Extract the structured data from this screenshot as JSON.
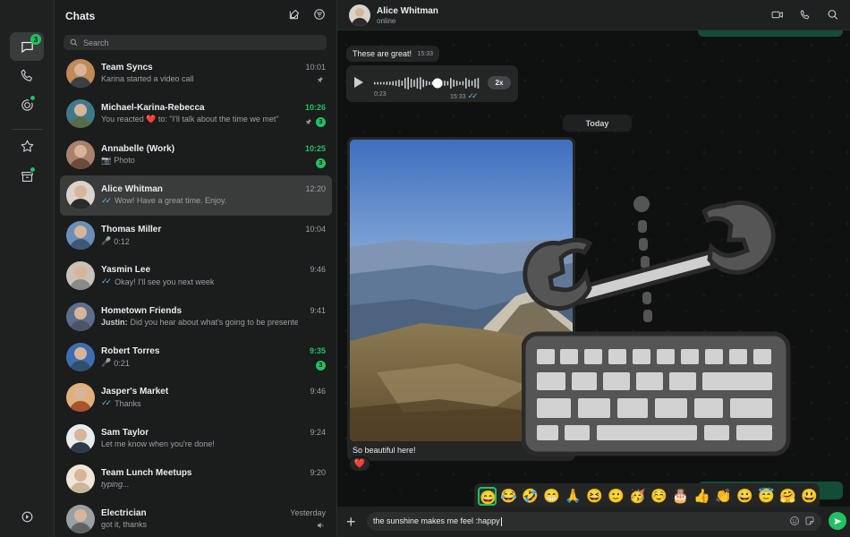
{
  "rail": {
    "chats_badge": "3",
    "icons": [
      "chats-icon",
      "calls-icon",
      "status-icon",
      "starred-icon",
      "archived-icon",
      "settings-icon"
    ]
  },
  "list": {
    "title": "Chats",
    "search_placeholder": "Search",
    "chats": [
      {
        "name": "Team Syncs",
        "time": "10:01",
        "preview": "Karina started a video call",
        "pinned": true,
        "color": "#c28a55"
      },
      {
        "name": "Michael-Karina-Rebecca",
        "time": "10:26",
        "time_green": true,
        "preview": "You reacted ❤️ to: \"I'll talk about the time we met\"",
        "pinned": true,
        "badge": "3",
        "color": "#3f7a8a"
      },
      {
        "name": "Annabelle (Work)",
        "time": "10:25",
        "time_green": true,
        "preview_icon": "📷",
        "preview": "Photo",
        "badge": "3",
        "color": "#a8826a"
      },
      {
        "name": "Alice Whitman",
        "time": "12:20",
        "ticks": true,
        "preview": "Wow! Have a great time. Enjoy.",
        "active": true,
        "color": "#d9d3cc"
      },
      {
        "name": "Thomas Miller",
        "time": "10:04",
        "preview_icon": "🎤",
        "preview": "0:12",
        "color": "#6a8fb8"
      },
      {
        "name": "Yasmin Lee",
        "time": "9:46",
        "ticks": true,
        "preview": "Okay! I'll see you next week",
        "color": "#c9c2b7"
      },
      {
        "name": "Hometown Friends",
        "time": "9:41",
        "preview_bold": "Justin:",
        "preview": "Did you hear about what's going to be presented?",
        "color": "#5b6f8c"
      },
      {
        "name": "Robert Torres",
        "time": "9:35",
        "time_green": true,
        "preview_icon": "🎤",
        "preview": "0:21",
        "badge": "3",
        "color": "#3d6fb0"
      },
      {
        "name": "Jasper's Market",
        "time": "9:46",
        "ticks": true,
        "preview": "Thanks",
        "color": "#e0b07a"
      },
      {
        "name": "Sam Taylor",
        "time": "9:24",
        "preview": "Let me know when you're done!",
        "color": "#e8ecef"
      },
      {
        "name": "Team Lunch Meetups",
        "time": "9:20",
        "preview": "typing...",
        "typing": true,
        "color": "#efe6d8"
      },
      {
        "name": "Electrician",
        "time": "Yesterday",
        "preview": "got it, thanks",
        "muted": true,
        "color": "#9aa0a3"
      }
    ]
  },
  "conversation": {
    "contact_name": "Alice Whitman",
    "contact_status": "online",
    "header_icons": [
      "video-call-icon",
      "voice-call-icon",
      "search-icon"
    ],
    "messages": {
      "text1": "These are great!",
      "text1_time": "15:33",
      "voice_duration": "0:23",
      "voice_time": "15:33",
      "voice_speed": "2x",
      "date_divider": "Today",
      "photo_caption": "So beautiful here!",
      "reaction": "❤️"
    },
    "emoji_suggestions": [
      "😄",
      "😂",
      "🤣",
      "😁",
      "🙏",
      "😆",
      "🙂",
      "🥳",
      "☺️",
      "🎂",
      "👍",
      "👏",
      "😀",
      "😇",
      "🤗",
      "😃"
    ],
    "composer": {
      "text": "the sunshine makes me feel :happy"
    }
  },
  "colors": {
    "accent": "#21c063",
    "outgoing_bubble": "#144d37",
    "incoming_bubble": "#242626",
    "read_ticks": "#53bdeb"
  }
}
